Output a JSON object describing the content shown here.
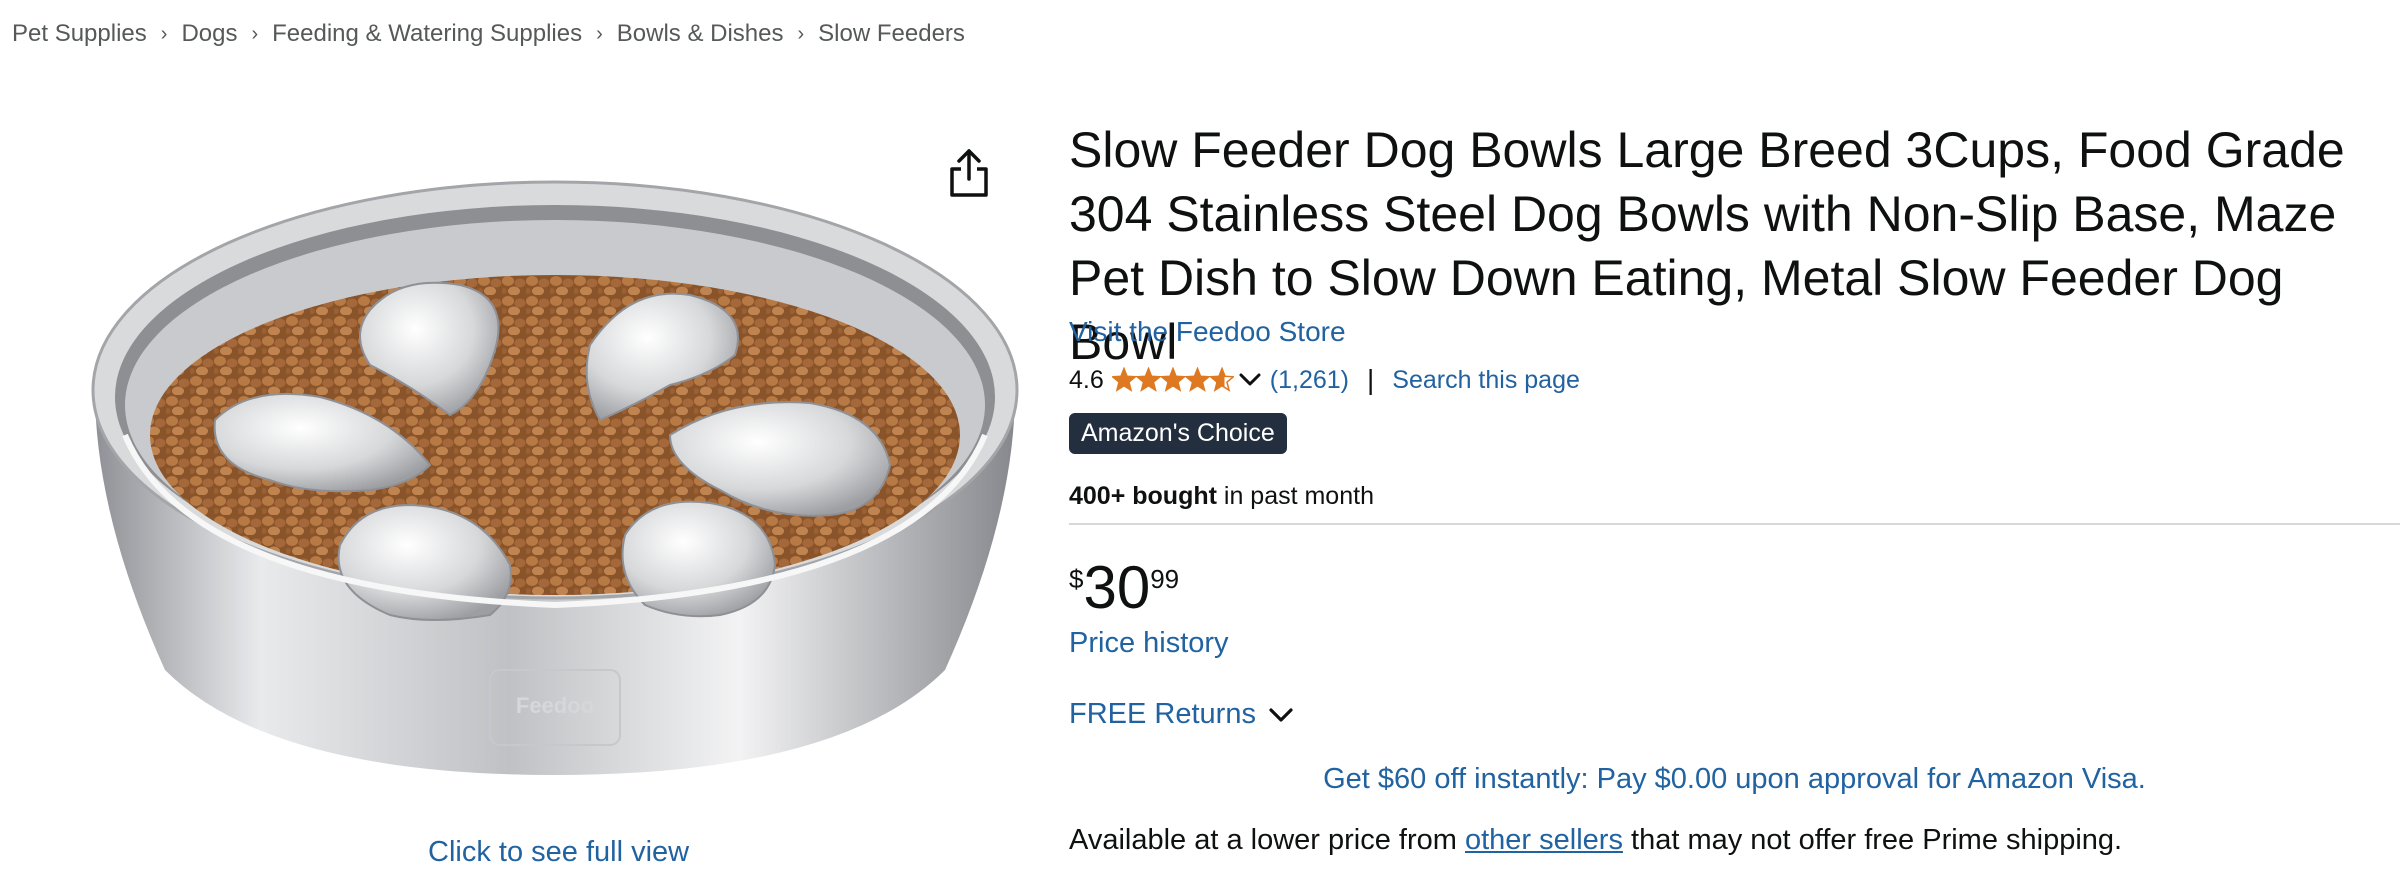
{
  "breadcrumb": [
    "Pet Supplies",
    "Dogs",
    "Feeding & Watering Supplies",
    "Bowls & Dishes",
    "Slow Feeders"
  ],
  "breadcrumb_separator": "›",
  "image": {
    "alt": "Slow feeder dog bowl product image",
    "full_view_label": "Click to see full view",
    "logo_text": "Feedoo"
  },
  "product": {
    "title": "Slow Feeder Dog Bowls Large Breed 3Cups, Food Grade 304 Stainless Steel Dog Bowls with Non-Slip Base, Maze Pet Dish to Slow Down Eating, Metal Slow Feeder Dog Bowl",
    "store_link": "Visit the Feedoo Store",
    "rating": "4.6",
    "rating_stars": 4.6,
    "review_count": "(1,261)",
    "search_page_label": "Search this page",
    "badge": "Amazon's Choice",
    "bought_strong": "400+ bought",
    "bought_rest": " in past month",
    "price_symbol": "$",
    "price_whole": "30",
    "price_fraction": "99",
    "price_history_label": "Price history",
    "returns_label": "FREE Returns",
    "promo": "Get $60 off instantly: Pay $0.00 upon approval for Amazon Visa.",
    "lower_price_prefix": "Available at a lower price from ",
    "lower_price_link": "other sellers",
    "lower_price_suffix": " that may not offer free Prime shipping."
  },
  "colors": {
    "link": "#2162a1",
    "text": "#0f1111",
    "star": "#de7921",
    "badge_bg": "#232f3e"
  }
}
